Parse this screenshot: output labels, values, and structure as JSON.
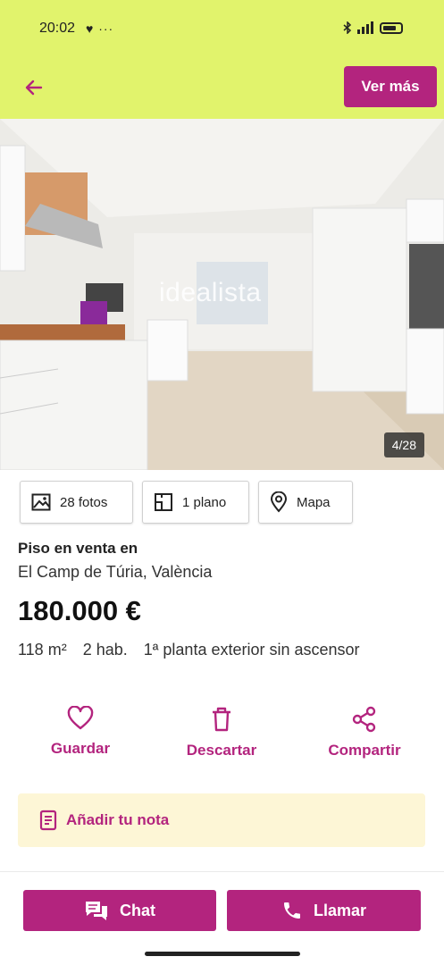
{
  "status_bar": {
    "time": "20:02",
    "left_icons": "♥ ···"
  },
  "header": {
    "back_icon": "arrow-left-icon",
    "more_button": "Ver más"
  },
  "gallery": {
    "counter": "4/28",
    "watermark": "idealista"
  },
  "media": {
    "photos": "28 fotos",
    "plan": "1 plano",
    "map": "Mapa"
  },
  "listing": {
    "title": "Piso en venta en",
    "location": "El Camp de Túria, València",
    "price": "180.000 €",
    "features": [
      "118 m²",
      "2 hab.",
      "1ª planta exterior sin ascensor"
    ]
  },
  "actions": {
    "save": "Guardar",
    "discard": "Descartar",
    "share": "Compartir"
  },
  "note": {
    "label": "Añadir tu nota"
  },
  "contact": {
    "chat": "Chat",
    "call": "Llamar"
  },
  "colors": {
    "brand": "#b3247e",
    "header_bg": "#e1f36c",
    "note_bg": "#fdf6d6"
  }
}
